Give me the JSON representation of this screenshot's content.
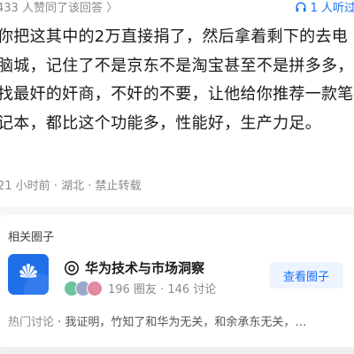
{
  "topbar": {
    "vote_summary": "433 人赞同了该回答 〉",
    "listen_label": "1 人听过"
  },
  "answer": {
    "text": "你把这其中的2万直接捐了，然后拿着剩下的去电脑城，记住了不是京东不是淘宝甚至不是拼多多，找最奸的奸商，不奸的不要，让他给你推荐一款笔记本，都比这个功能多，性能好，生产力足。"
  },
  "meta": {
    "time_location": "21 小时前 · 湖北 · 禁止转载"
  },
  "related_circle": {
    "section_title": "相关圈子",
    "name": "华为技术与市场洞察",
    "stats": "196 圈友 · 146 讨论",
    "view_button_label": "查看圈子",
    "hot_label": "热门讨论",
    "hot_text": " · 我证明，竹知了和华为无关，和余承东无关，…"
  },
  "colors": {
    "accent": "#1772f6",
    "logo_bg": "#1f6fe8",
    "muted_text": "#8a8a8a"
  },
  "icons": {
    "listen": "headphone-icon",
    "circle_name": "target-icon",
    "logo": "huawei-logo-icon"
  }
}
